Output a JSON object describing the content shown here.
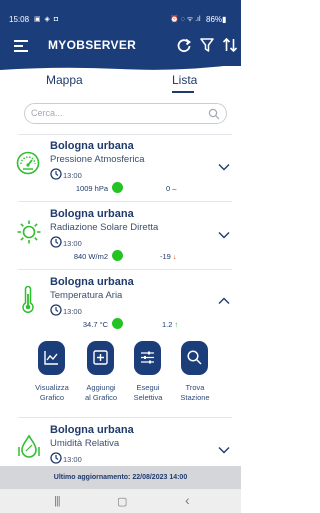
{
  "status_bar": {
    "time": "15:08",
    "left_icons": "▣ ◈ ◘",
    "right_icons": "⏰ ◌ ᯤ .ıl",
    "battery": "86%▮"
  },
  "header": {
    "title": "MYOBSERVER",
    "icons": [
      "refresh-icon",
      "filter-icon",
      "sort-icon"
    ]
  },
  "tabs": [
    {
      "label": "Mappa",
      "active": false
    },
    {
      "label": "Lista",
      "active": true
    }
  ],
  "search": {
    "placeholder": "Cerca..."
  },
  "stations": [
    {
      "name": "Bologna urbana",
      "parameter": "Pressione Atmosferica",
      "time": "13:00",
      "value": "1009 hPa",
      "trend": "0",
      "trend_sign": "–",
      "icon": "gauge-icon"
    },
    {
      "name": "Bologna urbana",
      "parameter": "Radiazione Solare Diretta",
      "time": "13:00",
      "value": "840 W/m2",
      "trend": "-19",
      "trend_sign": "↓",
      "icon": "sun-icon"
    },
    {
      "name": "Bologna urbana",
      "parameter": "Temperatura Aria",
      "time": "13:00",
      "value": "34.7 °C",
      "trend": "1.2",
      "trend_sign": "↑",
      "icon": "thermometer-icon"
    },
    {
      "name": "Bologna urbana",
      "parameter": "Umidità Relativa",
      "time": "13:00",
      "icon": "humidity-icon"
    }
  ],
  "actions": [
    {
      "line1": "Visualizza",
      "line2": "Grafico",
      "icon": "chart-icon"
    },
    {
      "line1": "Aggiungi",
      "line2": "al Grafico",
      "icon": "add-box-icon"
    },
    {
      "line1": "Esegui",
      "line2": "Selettiva",
      "icon": "sliders-icon"
    },
    {
      "line1": "Trova",
      "line2": "Stazione",
      "icon": "search-icon"
    }
  ],
  "footer": {
    "last_update": "Ultimo aggiornamento: 22/08/2023 14:00"
  },
  "nav": {
    "recents": "|||",
    "home": "▢",
    "back": "‹"
  },
  "colors": {
    "primary": "#1b3d7a",
    "ok_dot": "#22c422",
    "icon_green": "#2fbf2f",
    "trend_down": "#e0482c",
    "trend_up": "#2fbf2f"
  }
}
